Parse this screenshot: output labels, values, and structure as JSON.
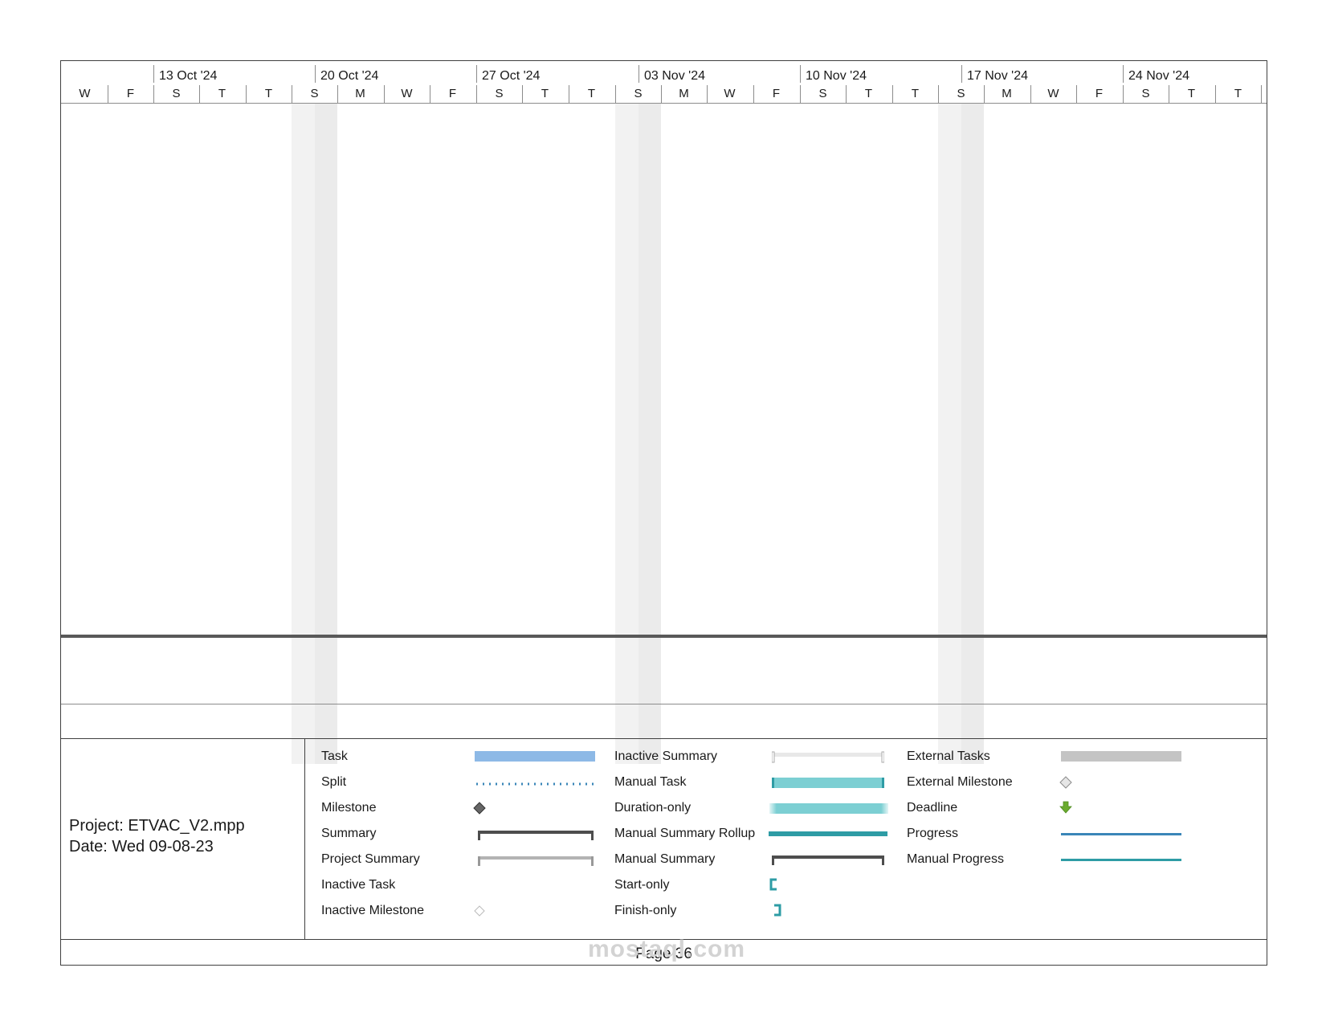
{
  "timescale": {
    "weeks": [
      "13 Oct '24",
      "20 Oct '24",
      "27 Oct '24",
      "03 Nov '24",
      "10 Nov '24",
      "17 Nov '24",
      "24 Nov '24"
    ],
    "days": [
      "W",
      "F",
      "S",
      "T",
      "T",
      "S",
      "M",
      "W",
      "F",
      "S",
      "T",
      "T",
      "S",
      "M",
      "W",
      "F",
      "S",
      "T",
      "T",
      "S",
      "M",
      "W",
      "F",
      "S",
      "T",
      "T"
    ]
  },
  "project_info": {
    "project": "Project: ETVAC_V2.mpp",
    "date": "Date: Wed 09-08-23"
  },
  "legend": {
    "col1": [
      "Task",
      "Split",
      "Milestone",
      "Summary",
      "Project Summary",
      "Inactive Task",
      "Inactive Milestone"
    ],
    "col2": [
      "Inactive Summary",
      "Manual Task",
      "Duration-only",
      "Manual Summary Rollup",
      "Manual Summary",
      "Start-only",
      "Finish-only"
    ],
    "col3": [
      "External Tasks",
      "External Milestone",
      "Deadline",
      "Progress",
      "Manual Progress"
    ]
  },
  "colors": {
    "task": "#8db9e6",
    "manual_task": "#7ccfd3",
    "teal": "#2e9ca5",
    "summary": "#4d4d4d",
    "external": "#c4c4c4",
    "progress": "#3a86b8",
    "deadline": "#6aab2e"
  },
  "footer": {
    "page": "Page 36"
  },
  "watermark": {
    "text": "mostaql.com"
  }
}
